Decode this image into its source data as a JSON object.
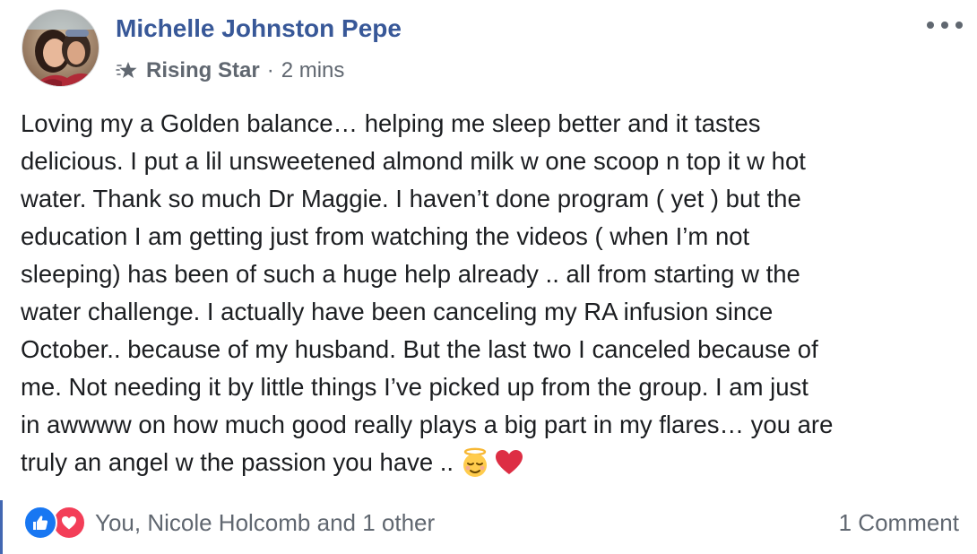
{
  "post": {
    "author": "Michelle Johnston Pepe",
    "badge": "Rising Star",
    "separator": "·",
    "time": "2 mins",
    "lines": [
      "Loving my a Golden balance… helping me sleep better and it tastes",
      "delicious. I put a lil unsweetened almond milk w one scoop n top it w hot",
      "water. Thank so much Dr Maggie. I haven’t done program ( yet ) but the",
      "education I am getting just from watching the videos ( when I’m not",
      "sleeping) has been of such a huge help already .. all from starting w the",
      "water challenge. I actually have been canceling my RA infusion since",
      "October.. because of my husband. But the last two I canceled because of",
      "me. Not needing it by little things I’ve picked up from the group. I am just",
      "in awwww on how much good really plays a big part in my flares… you are",
      "truly an angel w the passion you have .."
    ],
    "emojis": [
      "relieved-halo-face",
      "red-heart"
    ]
  },
  "reactions": {
    "types": [
      "like",
      "love"
    ],
    "names": "You, Nicole Holcomb and 1 other"
  },
  "comments": {
    "label": "1 Comment"
  },
  "colors": {
    "author": "#385898",
    "meta": "#606770",
    "text": "#1c1e21",
    "like": "#1877f2",
    "love": "#f33e58",
    "accent": "#4267b2"
  }
}
